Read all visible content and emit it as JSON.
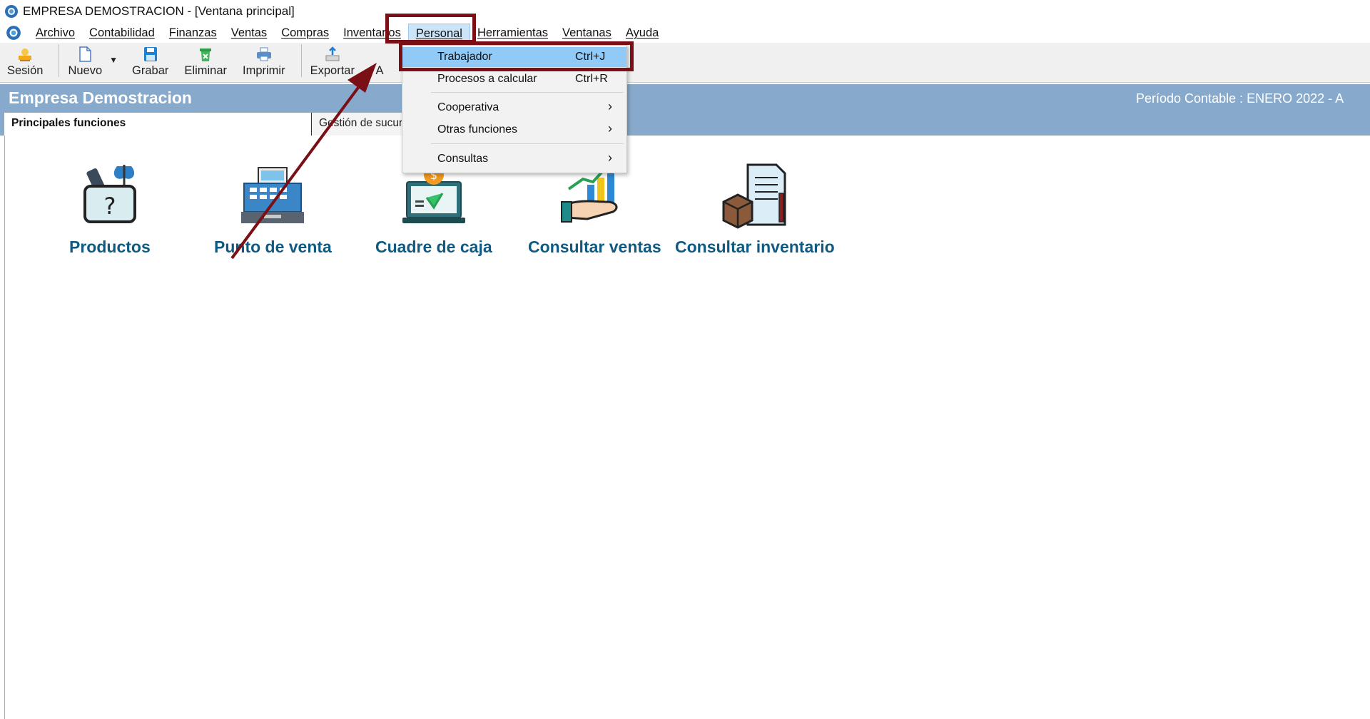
{
  "window": {
    "title": "EMPRESA DEMOSTRACION - [Ventana principal]"
  },
  "menubar": {
    "items": [
      {
        "label": "Archivo"
      },
      {
        "label": "Contabilidad"
      },
      {
        "label": "Finanzas"
      },
      {
        "label": "Ventas"
      },
      {
        "label": "Compras"
      },
      {
        "label": "Inventarios"
      },
      {
        "label": "Personal",
        "active": true
      },
      {
        "label": "Herramientas"
      },
      {
        "label": "Ventanas"
      },
      {
        "label": "Ayuda"
      }
    ]
  },
  "toolbar": {
    "sesion": "Sesión",
    "nuevo": "Nuevo",
    "grabar": "Grabar",
    "eliminar": "Eliminar",
    "imprimir": "Imprimir",
    "exportar": "Exportar",
    "next_partial": "A"
  },
  "header": {
    "company": "Empresa Demostracion",
    "period": "Período Contable : ENERO 2022    -    A"
  },
  "tabs": [
    {
      "label": "Principales funciones",
      "selected": true
    },
    {
      "label": "Gestión de sucursales"
    }
  ],
  "functions": [
    {
      "label": "Productos",
      "icon": "products-basket-icon"
    },
    {
      "label": "Punto de venta",
      "icon": "cash-register-icon"
    },
    {
      "label": "Cuadre de caja",
      "icon": "cash-balance-laptop-icon"
    },
    {
      "label": "Consultar ventas",
      "icon": "sales-chart-hand-icon"
    },
    {
      "label": "Consultar inventario",
      "icon": "inventory-document-box-icon"
    }
  ],
  "personal_menu": {
    "items": [
      {
        "label": "Trabajador",
        "shortcut": "Ctrl+J",
        "highlighted": true
      },
      {
        "label": "Procesos a calcular",
        "shortcut": "Ctrl+R"
      },
      {
        "label": "Cooperativa",
        "submenu_glyph": "›"
      },
      {
        "label": "Otras funciones",
        "submenu_glyph": "›"
      },
      {
        "label": "Consultas",
        "submenu_glyph": "›"
      }
    ]
  },
  "colors": {
    "header_band": "#87aacc",
    "function_label": "#0f5a82",
    "menu_highlight": "#91c9f7",
    "annotation": "#7a0f16"
  }
}
